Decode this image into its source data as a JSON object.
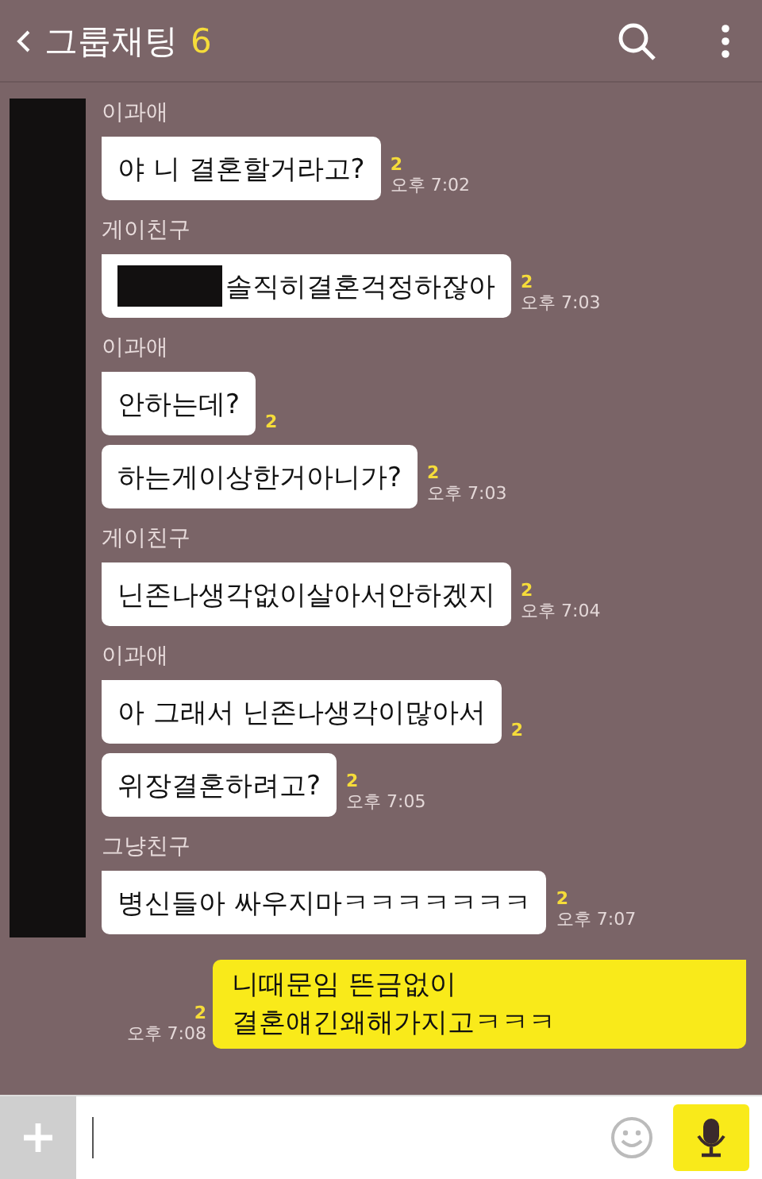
{
  "header": {
    "title": "그룹채팅",
    "member_count": "6"
  },
  "avatar_column": {
    "redacted": true
  },
  "groups": [
    {
      "sender": "이과애",
      "bubbles": [
        {
          "text": "야 니 결혼할거라고?",
          "redacted": false,
          "unread": "2",
          "time": "오후 7:02"
        }
      ]
    },
    {
      "sender": "게이친구",
      "bubbles": [
        {
          "text": "솔직히결혼걱정하잖아",
          "redacted": true,
          "unread": "2",
          "time": "오후 7:03"
        }
      ]
    },
    {
      "sender": "이과애",
      "bubbles": [
        {
          "text": "안하는데?",
          "redacted": false,
          "unread": "2"
        },
        {
          "text": "하는게이상한거아니가?",
          "redacted": false,
          "unread": "2",
          "time": "오후 7:03"
        }
      ]
    },
    {
      "sender": "게이친구",
      "bubbles": [
        {
          "text": "닌존나생각없이살아서안하겠지",
          "redacted": false,
          "unread": "2",
          "time": "오후 7:04"
        }
      ]
    },
    {
      "sender": "이과애",
      "bubbles": [
        {
          "text": "아 그래서 닌존나생각이많아서",
          "redacted": false,
          "unread": "2"
        },
        {
          "text": "위장결혼하려고?",
          "redacted": false,
          "unread": "2",
          "time": "오후 7:05"
        }
      ]
    },
    {
      "sender": "그냥친구",
      "bubbles": [
        {
          "text": "병신들아 싸우지마ㅋㅋㅋㅋㅋㅋㅋ",
          "redacted": false,
          "unread": "2",
          "time": "오후 7:07"
        }
      ]
    }
  ],
  "outgoing": [
    {
      "text": "니때문임 뜬금없이\n결혼얘긴왜해가지고ㅋㅋㅋ",
      "unread": "2",
      "time": "오후 7:08"
    }
  ]
}
